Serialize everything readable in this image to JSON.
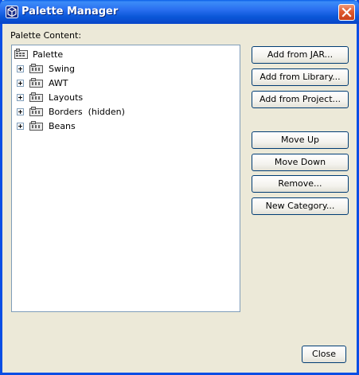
{
  "window": {
    "title": "Palette Manager",
    "app_icon": "netbeans-cube-icon",
    "close_icon": "close-icon"
  },
  "palette_content_label": "Palette Content:",
  "tree": {
    "root": {
      "label": "Palette",
      "icon": "palette-icon"
    },
    "categories": [
      {
        "label": "Swing",
        "icon": "folder-icon"
      },
      {
        "label": "AWT",
        "icon": "folder-icon"
      },
      {
        "label": "Layouts",
        "icon": "folder-icon"
      },
      {
        "label": "Borders  (hidden)",
        "icon": "folder-icon"
      },
      {
        "label": "Beans",
        "icon": "folder-icon"
      }
    ]
  },
  "buttons": {
    "add_from_jar": "Add from JAR...",
    "add_from_library": "Add from Library...",
    "add_from_project": "Add from Project...",
    "move_up": "Move Up",
    "move_down": "Move Down",
    "remove": "Remove...",
    "new_category": "New Category...",
    "close": "Close"
  },
  "colors": {
    "titlebar": "#0a5fe8",
    "window_bg": "#ece9d8",
    "button_border": "#003c74",
    "close_button": "#e05a2e"
  }
}
